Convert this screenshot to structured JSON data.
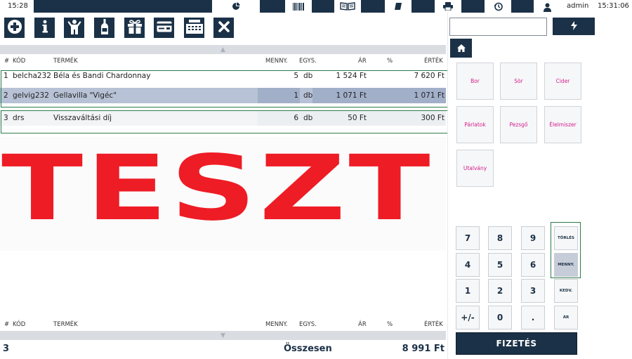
{
  "topbar": {
    "time_left": "15:28",
    "user": "admin",
    "clock": "15:31:06",
    "icons": [
      "pie-chart-icon",
      "barcode-icon",
      "book-icon",
      "notebook-icon",
      "printer-icon",
      "history-icon",
      "user-icon"
    ]
  },
  "toolbar": {
    "icons": [
      "plus-circle-icon",
      "info-icon",
      "person-icon",
      "bottle-icon",
      "gift-icon",
      "card-icon",
      "register-icon",
      "close-icon"
    ]
  },
  "table": {
    "headers": {
      "num": "#",
      "code": "KÓD",
      "product": "TERMÉK",
      "qty": "MENNY.",
      "unit": "EGYS.",
      "price": "ÁR",
      "pct": "%",
      "value": "ÉRTÉK"
    },
    "rows": [
      {
        "num": "1",
        "code": "belcha232",
        "product": "Béla és Bandi Chardonnay",
        "qty": "5",
        "unit": "db",
        "price": "1 524 Ft",
        "pct": "",
        "value": "7 620 Ft"
      },
      {
        "num": "2",
        "code": "gelvig232",
        "product": "Gellavilla \"Vigéc\"",
        "qty": "1",
        "unit": "db",
        "price": "1 071 Ft",
        "pct": "",
        "value": "1 071 Ft"
      },
      {
        "num": "3",
        "code": "drs",
        "product": "Visszaváltási díj",
        "qty": "6",
        "unit": "db",
        "price": "50 Ft",
        "pct": "",
        "value": "300 Ft"
      }
    ]
  },
  "watermark": "TESZT",
  "footer": {
    "count": "3",
    "label": "Összesen",
    "total": "8 991 Ft"
  },
  "search": {
    "value": "",
    "placeholder": ""
  },
  "categories": [
    "Bor",
    "Sör",
    "Cider",
    "Párlatok",
    "Pezsgő",
    "Élelmiszer",
    "Utalvány"
  ],
  "keypad": {
    "digits": [
      "7",
      "8",
      "9",
      "4",
      "5",
      "6",
      "1",
      "2",
      "3",
      "+/-",
      "0",
      "."
    ],
    "functions": [
      "TÖRLÉS",
      "MENNY.",
      "KEDV.",
      "ÁR"
    ]
  },
  "pay_label": "FIZETÉS",
  "colors": {
    "navy": "#1b3147",
    "accent_pink": "#d21e8c",
    "watermark_red": "#ee1c25",
    "outline_green": "#2e7a4b"
  }
}
